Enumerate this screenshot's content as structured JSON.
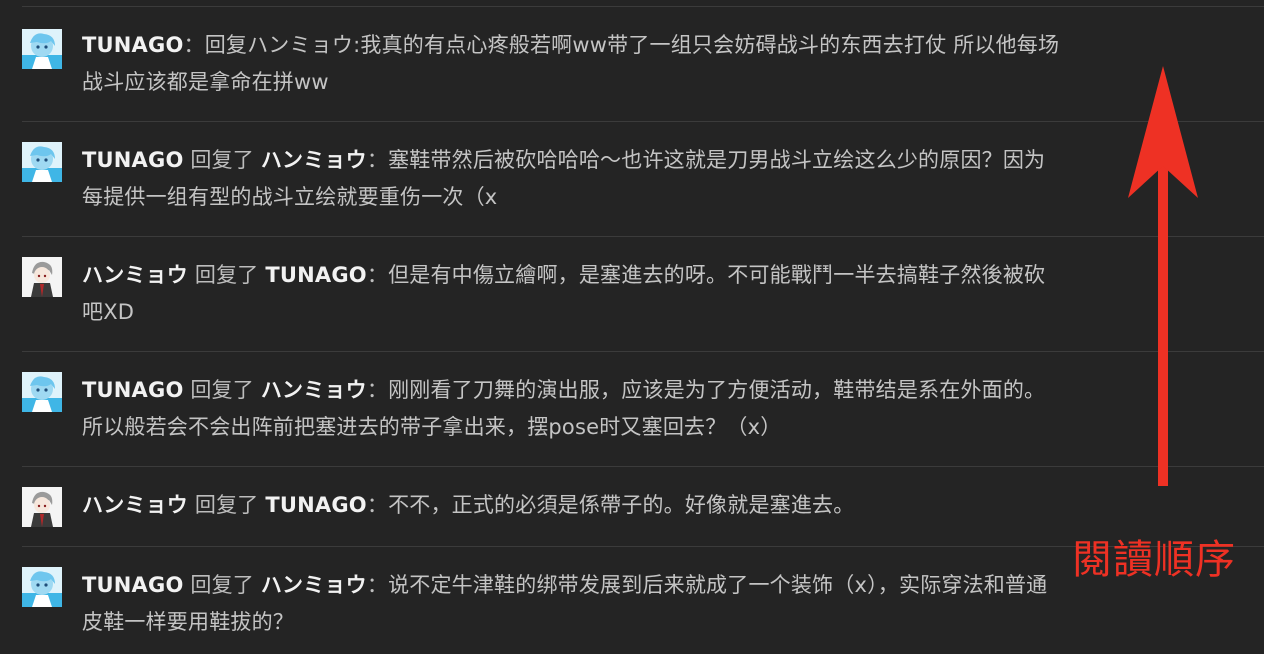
{
  "comments": [
    {
      "author": "TUNAGO",
      "verb": "",
      "target": "",
      "separator": "：",
      "body": "回复ハンミョウ:我真的有点心疼般若啊ww带了一组只会妨碍战斗的东西去打仗 所以他每场战斗应该都是拿命在拼ww",
      "avatar": "tunago-avatar"
    },
    {
      "author": "TUNAGO",
      "verb": " 回复了 ",
      "target": "ハンミョウ",
      "separator": "：",
      "body": "塞鞋带然后被砍哈哈哈～也许这就是刀男战斗立绘这么少的原因？因为每提供一组有型的战斗立绘就要重伤一次（x",
      "avatar": "tunago-avatar"
    },
    {
      "author": "ハンミョウ",
      "verb": " 回复了 ",
      "target": "TUNAGO",
      "separator": "：",
      "body": "但是有中傷立繪啊，是塞進去的呀。不可能戰鬥一半去搞鞋子然後被砍吧XD",
      "avatar": "hanmyou-avatar"
    },
    {
      "author": "TUNAGO",
      "verb": " 回复了 ",
      "target": "ハンミョウ",
      "separator": "：",
      "body": "刚刚看了刀舞的演出服，应该是为了方便活动，鞋带结是系在外面的。所以般若会不会出阵前把塞进去的带子拿出来，摆pose时又塞回去？（x）",
      "avatar": "tunago-avatar"
    },
    {
      "author": "ハンミョウ",
      "verb": " 回复了 ",
      "target": "TUNAGO",
      "separator": "：",
      "body": "不不，正式的必須是係帶子的。好像就是塞進去。",
      "avatar": "hanmyou-avatar"
    },
    {
      "author": "TUNAGO",
      "verb": " 回复了 ",
      "target": "ハンミョウ",
      "separator": "：",
      "body": "说不定牛津鞋的绑带发展到后来就成了一个装饰（x），实际穿法和普通皮鞋一样要用鞋拔的？",
      "avatar": "tunago-avatar"
    }
  ],
  "annotation": {
    "label": "閱讀順序",
    "icon": "up-arrow-icon",
    "color": "#ee3124"
  },
  "colors": {
    "background": "#242424",
    "username": "#f2f2f2",
    "text": "#c4c4c4",
    "divider": "#3b3b3b"
  }
}
